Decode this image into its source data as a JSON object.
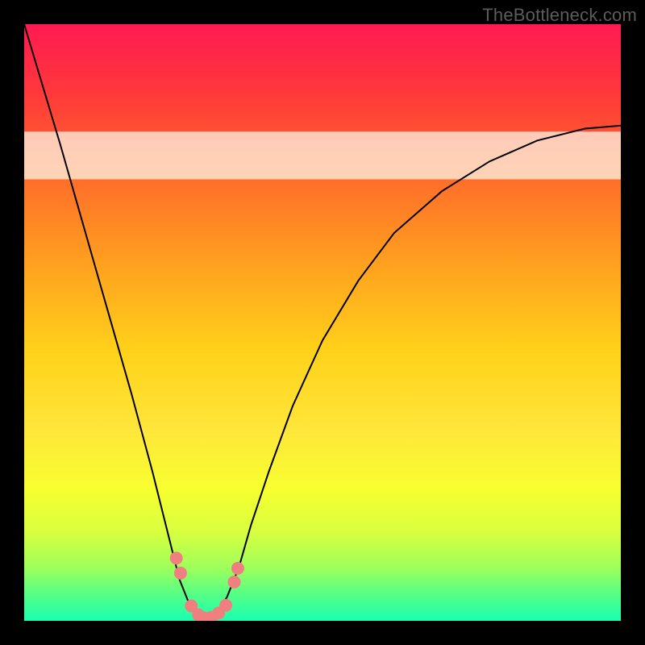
{
  "watermark": "TheBottleneck.com",
  "chart_data": {
    "type": "line",
    "title": "",
    "xlabel": "",
    "ylabel": "",
    "xlim": [
      0,
      100
    ],
    "ylim": [
      0,
      100
    ],
    "series": [
      {
        "name": "bottleneck-curve",
        "x": [
          0,
          3,
          6,
          10,
          14,
          18,
          21.5,
          24,
          26,
          28,
          29.5,
          30.5,
          32,
          34,
          36,
          38,
          41,
          45,
          50,
          56,
          62,
          70,
          78,
          86,
          94,
          100
        ],
        "y": [
          100,
          90,
          80,
          66,
          52,
          38,
          25,
          15,
          7,
          2,
          0,
          0,
          1,
          4,
          9,
          16,
          25,
          36,
          47,
          57,
          65,
          72,
          77,
          80.5,
          82.5,
          83
        ]
      }
    ],
    "markers": {
      "name": "curve-markers",
      "color": "#f08080",
      "points": [
        {
          "x": 25.5,
          "y": 10.5
        },
        {
          "x": 26.2,
          "y": 8
        },
        {
          "x": 28,
          "y": 2.5
        },
        {
          "x": 29.2,
          "y": 1
        },
        {
          "x": 30.2,
          "y": 0.5
        },
        {
          "x": 31.4,
          "y": 0.6
        },
        {
          "x": 32.6,
          "y": 1.3
        },
        {
          "x": 33.8,
          "y": 2.6
        },
        {
          "x": 35.2,
          "y": 6.5
        },
        {
          "x": 35.8,
          "y": 8.8
        }
      ]
    },
    "highlight_band": {
      "y0": 74,
      "y1": 82
    },
    "colors": {
      "curve": "#000000",
      "markers": "#f08080",
      "gradient_top": "#ff1a52",
      "gradient_bottom": "#1affb0"
    }
  }
}
